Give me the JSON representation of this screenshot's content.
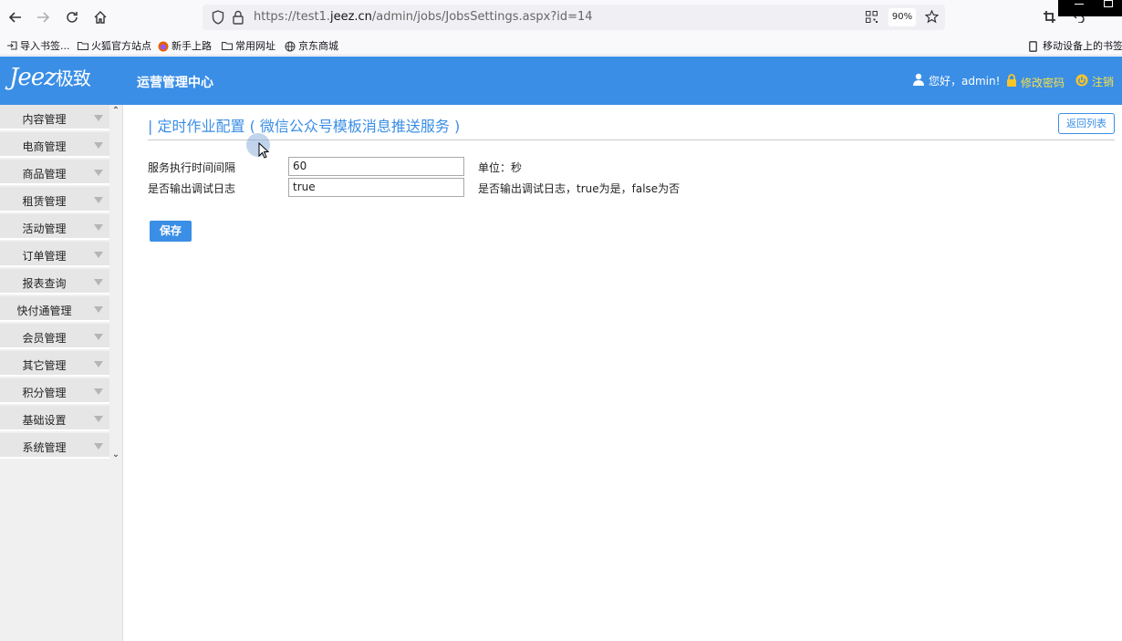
{
  "browser": {
    "url_prefix": "https://test1.",
    "url_domain": "jeez.cn",
    "url_path": "/admin/jobs/JobsSettings.aspx?id=14",
    "zoom": "90%",
    "bookmarks": [
      "导入书签...",
      "火狐官方站点",
      "新手上路",
      "常用网址",
      "京东商城"
    ],
    "mobile_bookmarks": "移动设备上的书签"
  },
  "header": {
    "logo_latin": "Jeez",
    "logo_cn": "极致",
    "system_title": "运营管理中心",
    "greeting": "您好，admin!",
    "change_password": "修改密码",
    "logout": "注销",
    "color": "#3a8ee6"
  },
  "sidebar": {
    "items": [
      "内容管理",
      "电商管理",
      "商品管理",
      "租赁管理",
      "活动管理",
      "订单管理",
      "报表查询",
      "快付通管理",
      "会员管理",
      "其它管理",
      "积分管理",
      "基础设置",
      "系统管理"
    ]
  },
  "main": {
    "title": "| 定时作业配置 ( 微信公众号模板消息推送服务 )",
    "back_button": "返回列表",
    "fields": [
      {
        "label": "服务执行时间间隔",
        "value": "60",
        "note": "单位：秒"
      },
      {
        "label": "是否输出调试日志",
        "value": "true",
        "note": "是否输出调试日志，true为是，false为否"
      }
    ],
    "save_button": "保存"
  }
}
